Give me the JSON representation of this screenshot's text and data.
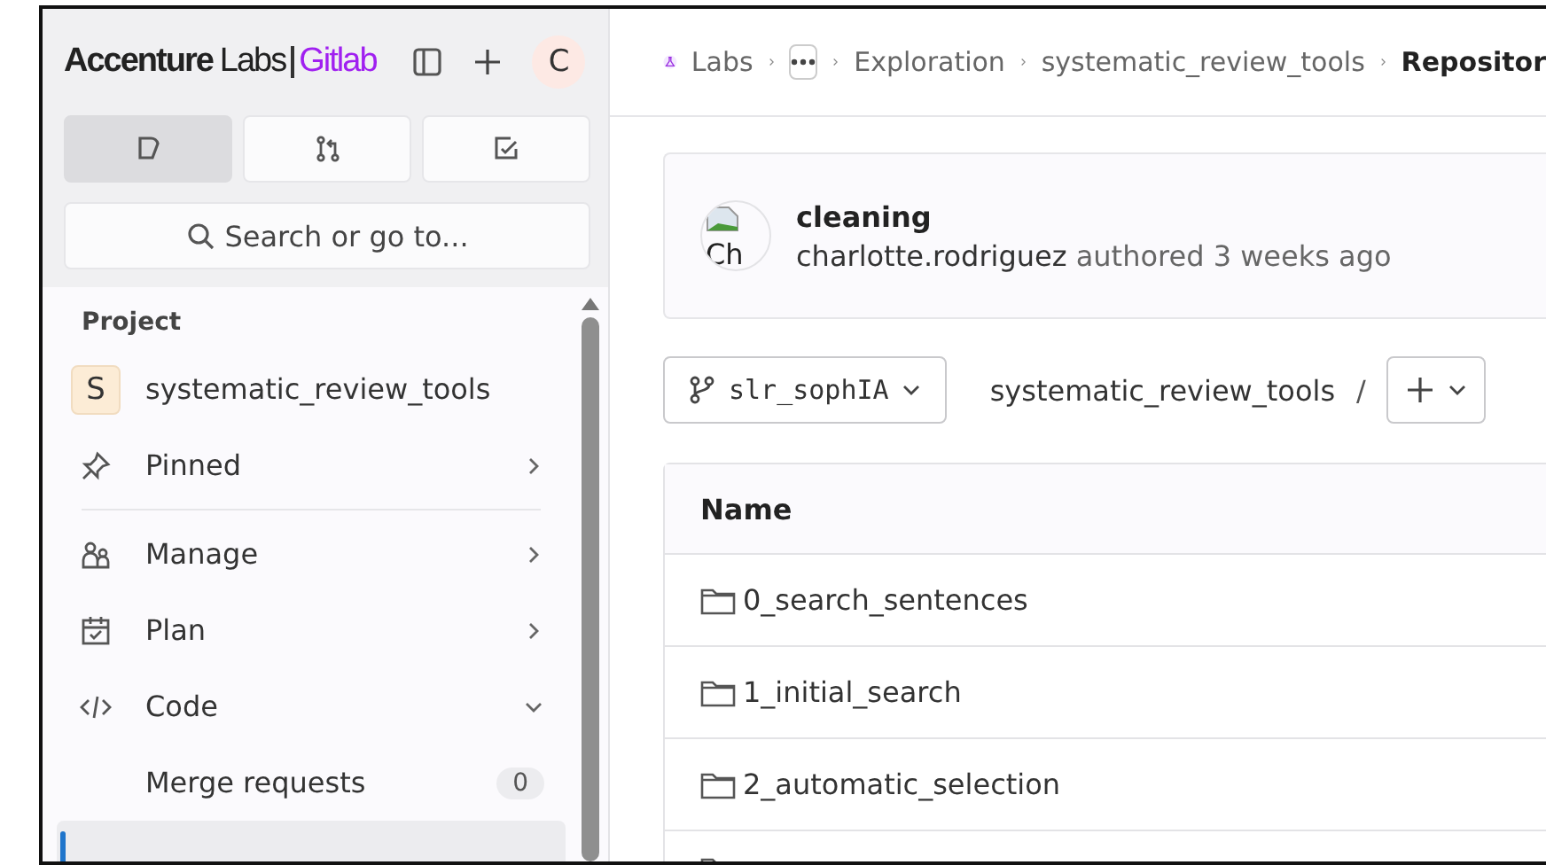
{
  "logo": {
    "brand": "Accenture",
    "suffix": "Labs",
    "product": "Gitlab"
  },
  "user_avatar": {
    "initial": "C"
  },
  "sidebar_tabs": [
    {
      "kind": "issues",
      "selected": true
    },
    {
      "kind": "merge",
      "selected": false
    },
    {
      "kind": "todo",
      "selected": false
    }
  ],
  "search": {
    "placeholder": "Search or go to..."
  },
  "sidebar": {
    "heading": "Project",
    "project": {
      "initial": "S",
      "name": "systematic_review_tools"
    },
    "items": [
      {
        "kind": "pin",
        "label": "Pinned",
        "expanded": false,
        "divider_after": true
      },
      {
        "kind": "people",
        "label": "Manage",
        "expanded": false
      },
      {
        "kind": "calendar",
        "label": "Plan",
        "expanded": false
      },
      {
        "kind": "code",
        "label": "Code",
        "expanded": true,
        "children": [
          {
            "label": "Merge requests",
            "count": "0",
            "selected": false
          },
          {
            "selected": true
          }
        ]
      }
    ]
  },
  "breadcrumb": [
    {
      "kind": "project",
      "label": "Labs"
    },
    {
      "kind": "more"
    },
    {
      "kind": "link",
      "label": "Exploration"
    },
    {
      "kind": "link",
      "label": "systematic_review_tools"
    },
    {
      "kind": "current",
      "label": "Repositor"
    }
  ],
  "commit": {
    "avatar_alt": "Ch",
    "title": "cleaning",
    "author": "charlotte.rodriguez",
    "meta": "authored 3 weeks ago"
  },
  "branch": {
    "name": "slr_sophIA",
    "path": "systematic_review_tools",
    "separator": "/"
  },
  "table": {
    "columns": [
      "Name"
    ],
    "rows": [
      {
        "name": "0_search_sentences"
      },
      {
        "name": "1_initial_search"
      },
      {
        "name": "2_automatic_selection"
      },
      {
        "kind": "cut"
      }
    ]
  }
}
